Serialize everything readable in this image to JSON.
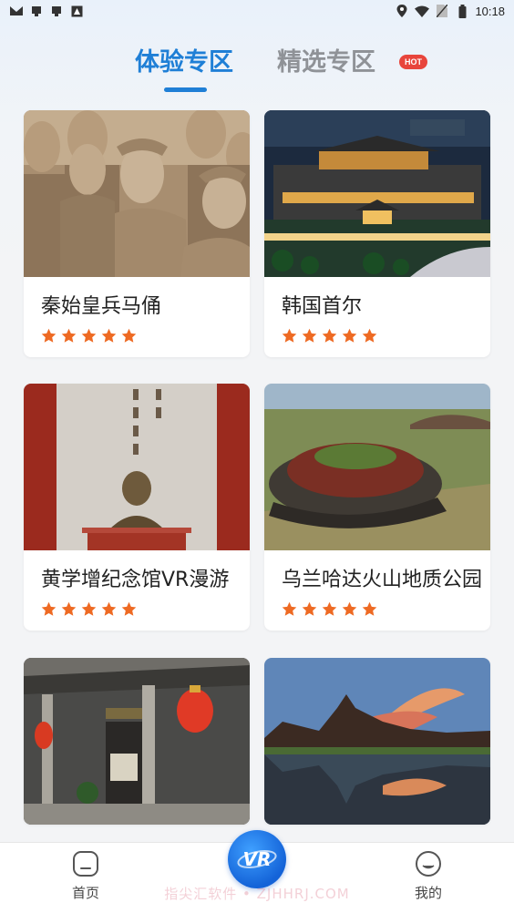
{
  "status_bar": {
    "time": "10:18",
    "left_icons": [
      "mail-icon",
      "notification-icon",
      "notification-icon",
      "app-icon"
    ],
    "right_icons": [
      "location-icon",
      "wifi-icon",
      "sim-icon",
      "battery-icon"
    ]
  },
  "tabs": [
    {
      "label": "体验专区",
      "active": true
    },
    {
      "label": "精选专区",
      "active": false,
      "badge": "HOT"
    }
  ],
  "cards": [
    {
      "title": "秦始皇兵马俑",
      "rating": 5,
      "image": "terracotta-warriors"
    },
    {
      "title": "韩国首尔",
      "rating": 5,
      "image": "seoul-palace-night"
    },
    {
      "title": "黄学增纪念馆VR漫游",
      "rating": 5,
      "image": "memorial-bust"
    },
    {
      "title": "乌兰哈达火山地质公园",
      "rating": 5,
      "image": "volcano-crater"
    },
    {
      "title": "",
      "rating": 0,
      "image": "ancestral-hall-lanterns"
    },
    {
      "title": "",
      "rating": 0,
      "image": "waterfront-pavilion"
    }
  ],
  "bottom_nav": {
    "home_label": "首页",
    "center_label": "VR",
    "mine_label": "我的"
  },
  "watermark": "指尖汇软件 • ZJHHRJ.COM",
  "colors": {
    "accent": "#1f7fd6",
    "inactive_tab": "#8f9297",
    "hot_badge": "#e8453c",
    "star": "#ee6a23"
  }
}
